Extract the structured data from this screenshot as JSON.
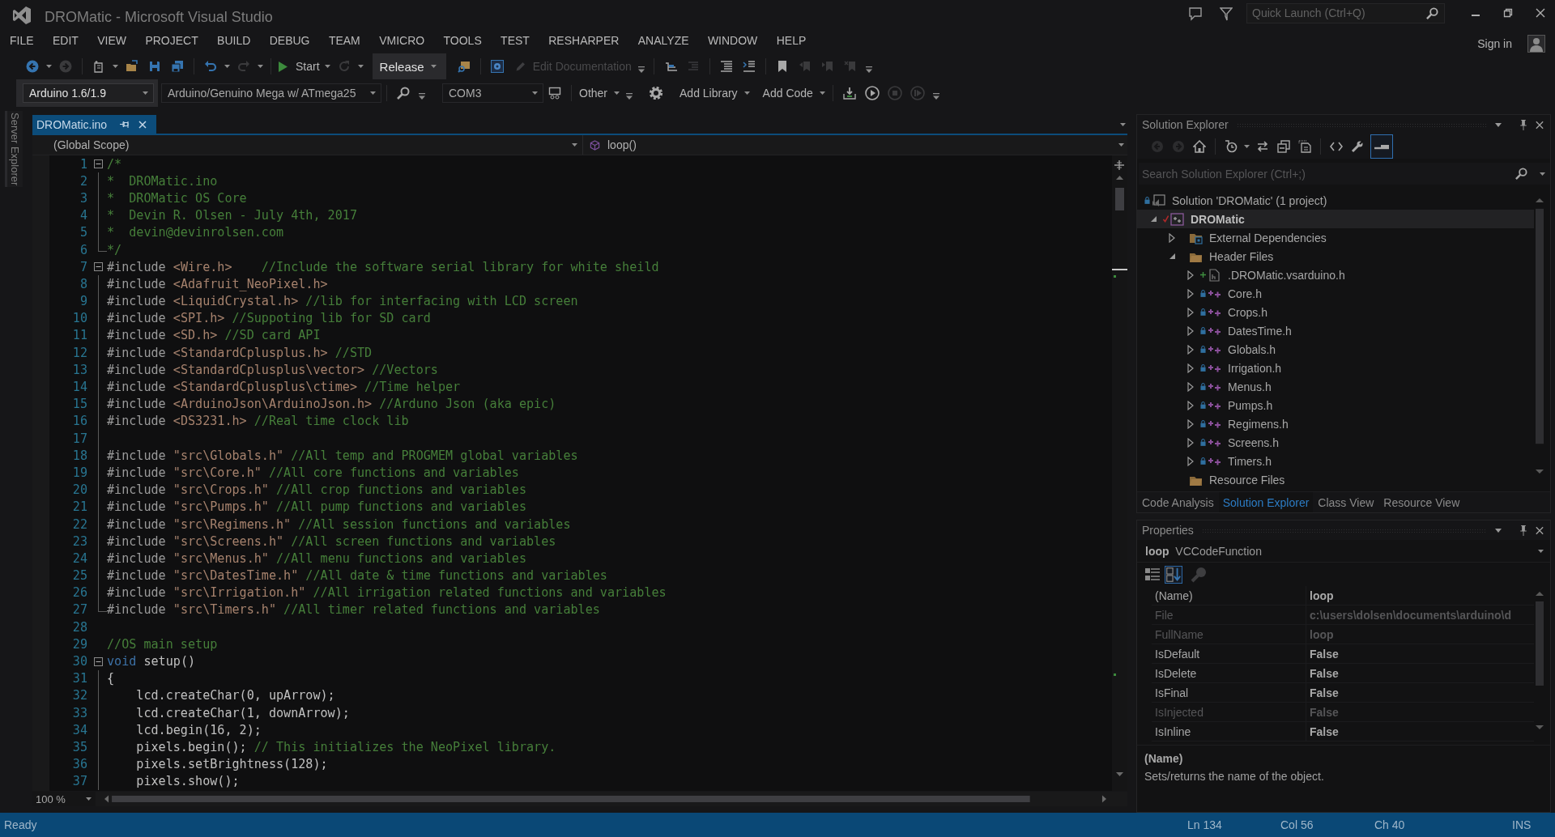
{
  "window": {
    "title": "DROMatic - Microsoft Visual Studio",
    "quick_launch": {
      "placeholder": "Quick Launch (Ctrl+Q)"
    }
  },
  "menu": [
    "FILE",
    "EDIT",
    "VIEW",
    "PROJECT",
    "BUILD",
    "DEBUG",
    "TEAM",
    "VMICRO",
    "TOOLS",
    "TEST",
    "RESHARPER",
    "ANALYZE",
    "WINDOW",
    "HELP"
  ],
  "account": {
    "sign_in": "Sign in"
  },
  "toolbar_1": {
    "start": "Start",
    "configuration": "Release",
    "edit_documentation": {
      "label": "Edit Documentation",
      "disabled": true
    }
  },
  "toolbar_2": {
    "ide_version": "Arduino 1.6/1.9",
    "board": "Arduino/Genuino Mega w/ ATmega25",
    "port": "COM3",
    "other": "Other",
    "add_library": "Add Library",
    "add_code": "Add Code"
  },
  "side_tabs": [
    "Server Explorer"
  ],
  "document_tabs": [
    {
      "label": "DROMatic.ino",
      "selected": true
    }
  ],
  "navigation": {
    "scope": "(Global Scope)",
    "member": "loop()"
  },
  "code": {
    "lines": [
      {
        "number": "1",
        "kind": "start",
        "segments": [
          {
            "kind": "comment",
            "text": "/*"
          }
        ]
      },
      {
        "number": "2",
        "kind": "inside",
        "segments": [
          {
            "kind": "comment",
            "text": "*  DROMatic.ino"
          }
        ]
      },
      {
        "number": "3",
        "kind": "inside",
        "segments": [
          {
            "kind": "comment",
            "text": "*  DROMatic OS Core"
          }
        ]
      },
      {
        "number": "4",
        "kind": "inside",
        "segments": [
          {
            "kind": "comment",
            "text": "*  Devin R. Olsen - July 4th, 2017"
          }
        ]
      },
      {
        "number": "5",
        "kind": "inside",
        "segments": [
          {
            "kind": "comment",
            "text": "*  devin@devinrolsen.com"
          }
        ]
      },
      {
        "number": "6",
        "kind": "end",
        "segments": [
          {
            "kind": "comment",
            "text": "*/"
          }
        ]
      },
      {
        "number": "7",
        "kind": "start",
        "segments": [
          {
            "kind": "directive",
            "text": "#include"
          },
          {
            "kind": "header",
            "text": " <Wire.h>"
          },
          {
            "kind": "comment",
            "text": "    //Include the software serial library for white sheild"
          }
        ]
      },
      {
        "number": "8",
        "kind": "inside",
        "segments": [
          {
            "kind": "directive",
            "text": "#include"
          },
          {
            "kind": "header",
            "text": " <Adafruit_NeoPixel.h>"
          }
        ]
      },
      {
        "number": "9",
        "kind": "inside",
        "segments": [
          {
            "kind": "directive",
            "text": "#include"
          },
          {
            "kind": "header",
            "text": " <LiquidCrystal.h>"
          },
          {
            "kind": "comment",
            "text": " //lib for interfacing with LCD screen"
          }
        ]
      },
      {
        "number": "10",
        "kind": "inside",
        "segments": [
          {
            "kind": "directive",
            "text": "#include"
          },
          {
            "kind": "header",
            "text": " <SPI.h>"
          },
          {
            "kind": "comment",
            "text": " //Suppoting lib for SD card"
          }
        ]
      },
      {
        "number": "11",
        "kind": "inside",
        "segments": [
          {
            "kind": "directive",
            "text": "#include"
          },
          {
            "kind": "header",
            "text": " <SD.h>"
          },
          {
            "kind": "comment",
            "text": " //SD card API"
          }
        ]
      },
      {
        "number": "12",
        "kind": "inside",
        "segments": [
          {
            "kind": "directive",
            "text": "#include"
          },
          {
            "kind": "header",
            "text": " <StandardCplusplus.h>"
          },
          {
            "kind": "comment",
            "text": " //STD"
          }
        ]
      },
      {
        "number": "13",
        "kind": "inside",
        "segments": [
          {
            "kind": "directive",
            "text": "#include"
          },
          {
            "kind": "header",
            "text": " <StandardCplusplus\\vector>"
          },
          {
            "kind": "comment",
            "text": " //Vectors"
          }
        ]
      },
      {
        "number": "14",
        "kind": "inside",
        "segments": [
          {
            "kind": "directive",
            "text": "#include"
          },
          {
            "kind": "header",
            "text": " <StandardCplusplus\\ctime>"
          },
          {
            "kind": "comment",
            "text": " //Time helper"
          }
        ]
      },
      {
        "number": "15",
        "kind": "inside",
        "segments": [
          {
            "kind": "directive",
            "text": "#include"
          },
          {
            "kind": "header",
            "text": " <ArduinoJson\\ArduinoJson.h>"
          },
          {
            "kind": "comment",
            "text": " //Arduno Json (aka epic)"
          }
        ]
      },
      {
        "number": "16",
        "kind": "inside",
        "segments": [
          {
            "kind": "directive",
            "text": "#include"
          },
          {
            "kind": "header",
            "text": " <DS3231.h>"
          },
          {
            "kind": "comment",
            "text": " //Real time clock lib"
          }
        ]
      },
      {
        "number": "17",
        "kind": "inside"
      },
      {
        "number": "18",
        "kind": "inside",
        "segments": [
          {
            "kind": "directive",
            "text": "#include"
          },
          {
            "kind": "string",
            "text": " \"src\\Globals.h\""
          },
          {
            "kind": "comment",
            "text": " //All temp and PROGMEM global variables"
          }
        ]
      },
      {
        "number": "19",
        "kind": "inside",
        "segments": [
          {
            "kind": "directive",
            "text": "#include"
          },
          {
            "kind": "string",
            "text": " \"src\\Core.h\""
          },
          {
            "kind": "comment",
            "text": " //All core functions and variables"
          }
        ]
      },
      {
        "number": "20",
        "kind": "inside",
        "segments": [
          {
            "kind": "directive",
            "text": "#include"
          },
          {
            "kind": "string",
            "text": " \"src\\Crops.h\""
          },
          {
            "kind": "comment",
            "text": " //All crop functions and variables"
          }
        ]
      },
      {
        "number": "21",
        "kind": "inside",
        "segments": [
          {
            "kind": "directive",
            "text": "#include"
          },
          {
            "kind": "string",
            "text": " \"src\\Pumps.h\""
          },
          {
            "kind": "comment",
            "text": " //All pump functions and variables"
          }
        ]
      },
      {
        "number": "22",
        "kind": "inside",
        "segments": [
          {
            "kind": "directive",
            "text": "#include"
          },
          {
            "kind": "string",
            "text": " \"src\\Regimens.h\""
          },
          {
            "kind": "comment",
            "text": " //All session functions and variables"
          }
        ]
      },
      {
        "number": "23",
        "kind": "inside",
        "segments": [
          {
            "kind": "directive",
            "text": "#include"
          },
          {
            "kind": "string",
            "text": " \"src\\Screens.h\""
          },
          {
            "kind": "comment",
            "text": " //All screen functions and variables"
          }
        ]
      },
      {
        "number": "24",
        "kind": "inside",
        "segments": [
          {
            "kind": "directive",
            "text": "#include"
          },
          {
            "kind": "string",
            "text": " \"src\\Menus.h\""
          },
          {
            "kind": "comment",
            "text": " //All menu functions and variables"
          }
        ]
      },
      {
        "number": "25",
        "kind": "inside",
        "segments": [
          {
            "kind": "directive",
            "text": "#include"
          },
          {
            "kind": "string",
            "text": " \"src\\DatesTime.h\""
          },
          {
            "kind": "comment",
            "text": " //All date & time functions and variables"
          }
        ]
      },
      {
        "number": "26",
        "kind": "inside",
        "segments": [
          {
            "kind": "directive",
            "text": "#include"
          },
          {
            "kind": "string",
            "text": " \"src\\Irrigation.h\""
          },
          {
            "kind": "comment",
            "text": " //All irrigation related functions and variables"
          }
        ]
      },
      {
        "number": "27",
        "kind": "end",
        "segments": [
          {
            "kind": "directive",
            "text": "#include"
          },
          {
            "kind": "string",
            "text": " \"src\\Timers.h\""
          },
          {
            "kind": "comment",
            "text": " //All timer related functions and variables"
          }
        ]
      },
      {
        "number": "28",
        "kind": "plain"
      },
      {
        "number": "29",
        "kind": "plain",
        "segments": [
          {
            "kind": "comment",
            "text": "//OS main setup"
          }
        ]
      },
      {
        "number": "30",
        "kind": "start",
        "segments": [
          {
            "kind": "keyword",
            "text": "void"
          },
          {
            "kind": "plain",
            "text": " setup()"
          }
        ]
      },
      {
        "number": "31",
        "kind": "inside",
        "segments": [
          {
            "kind": "plain",
            "text": "{"
          }
        ]
      },
      {
        "number": "32",
        "kind": "inside",
        "segments": [
          {
            "kind": "plain",
            "text": "    lcd.createChar(0, upArrow);"
          }
        ]
      },
      {
        "number": "33",
        "kind": "inside",
        "segments": [
          {
            "kind": "plain",
            "text": "    lcd.createChar(1, downArrow);"
          }
        ]
      },
      {
        "number": "34",
        "kind": "inside",
        "segments": [
          {
            "kind": "plain",
            "text": "    lcd.begin(16, 2);"
          }
        ]
      },
      {
        "number": "35",
        "kind": "inside",
        "segments": [
          {
            "kind": "plain",
            "text": "    pixels.begin();"
          },
          {
            "kind": "comment",
            "text": " // This initializes the NeoPixel library."
          }
        ]
      },
      {
        "number": "36",
        "kind": "inside",
        "segments": [
          {
            "kind": "plain",
            "text": "    pixels.setBrightness(128);"
          }
        ]
      },
      {
        "number": "37",
        "kind": "inside",
        "segments": [
          {
            "kind": "plain",
            "text": "    pixels.show();"
          }
        ]
      }
    ]
  },
  "zoom": "100 %",
  "solution_explorer": {
    "title": "Solution Explorer",
    "preview_selected": true,
    "search": {
      "placeholder": "Search Solution Explorer (Ctrl+;)"
    },
    "tree": [
      {
        "label": "Solution 'DROMatic' (1 project)",
        "kind": "solution",
        "checked_in": true,
        "pending_add": false,
        "checked_out": false,
        "selected": false,
        "children": [
          {
            "label": "DROMatic",
            "kind": "project",
            "expanded": true,
            "checked_in": false,
            "pending_add": false,
            "checked_out": true,
            "selected": true,
            "children": [
              {
                "label": "External Dependencies",
                "kind": "dependencies",
                "expanded": false,
                "checked_in": false,
                "pending_add": false,
                "checked_out": false,
                "selected": false
              },
              {
                "label": "Header Files",
                "kind": "folder",
                "expanded": true,
                "checked_in": false,
                "pending_add": false,
                "checked_out": false,
                "selected": false,
                "children": [
                  {
                    "label": ".DROMatic.vsarduino.h",
                    "kind": "file",
                    "expanded": false,
                    "checked_in": false,
                    "pending_add": true,
                    "checked_out": false,
                    "selected": false
                  },
                  {
                    "label": "Core.h",
                    "kind": "header",
                    "expanded": false,
                    "checked_in": true,
                    "pending_add": false,
                    "checked_out": false,
                    "selected": false
                  },
                  {
                    "label": "Crops.h",
                    "kind": "header",
                    "expanded": false,
                    "checked_in": true,
                    "pending_add": false,
                    "checked_out": false,
                    "selected": false
                  },
                  {
                    "label": "DatesTime.h",
                    "kind": "header",
                    "expanded": false,
                    "checked_in": true,
                    "pending_add": false,
                    "checked_out": false,
                    "selected": false
                  },
                  {
                    "label": "Globals.h",
                    "kind": "header",
                    "expanded": false,
                    "checked_in": true,
                    "pending_add": false,
                    "checked_out": false,
                    "selected": false
                  },
                  {
                    "label": "Irrigation.h",
                    "kind": "header",
                    "expanded": false,
                    "checked_in": true,
                    "pending_add": false,
                    "checked_out": false,
                    "selected": false
                  },
                  {
                    "label": "Menus.h",
                    "kind": "header",
                    "expanded": false,
                    "checked_in": true,
                    "pending_add": false,
                    "checked_out": false,
                    "selected": false
                  },
                  {
                    "label": "Pumps.h",
                    "kind": "header",
                    "expanded": false,
                    "checked_in": true,
                    "pending_add": false,
                    "checked_out": false,
                    "selected": false
                  },
                  {
                    "label": "Regimens.h",
                    "kind": "header",
                    "expanded": false,
                    "checked_in": true,
                    "pending_add": false,
                    "checked_out": false,
                    "selected": false
                  },
                  {
                    "label": "Screens.h",
                    "kind": "header",
                    "expanded": false,
                    "checked_in": true,
                    "pending_add": false,
                    "checked_out": false,
                    "selected": false
                  },
                  {
                    "label": "Timers.h",
                    "kind": "header",
                    "expanded": false,
                    "checked_in": true,
                    "pending_add": false,
                    "checked_out": false,
                    "selected": false
                  }
                ]
              },
              {
                "label": "Resource Files",
                "kind": "empty_folder",
                "expanded": false,
                "checked_in": false,
                "pending_add": false,
                "checked_out": false,
                "selected": false
              }
            ]
          }
        ]
      }
    ],
    "tabs": [
      {
        "label": "Code Analysis",
        "selected": false
      },
      {
        "label": "Solution Explorer",
        "selected": true
      },
      {
        "label": "Class View",
        "selected": false
      },
      {
        "label": "Resource View",
        "selected": false
      }
    ]
  },
  "properties": {
    "title": "Properties",
    "object_name": "loop",
    "object_type": "VCCodeFunction",
    "sort_alphabetical": true,
    "rows": [
      {
        "name": "(Name)",
        "value": "loop",
        "disabled": false
      },
      {
        "name": "File",
        "value": "c:\\users\\dolsen\\documents\\arduino\\d",
        "disabled": true
      },
      {
        "name": "FullName",
        "value": "loop",
        "disabled": true
      },
      {
        "name": "IsDefault",
        "value": "False",
        "disabled": false
      },
      {
        "name": "IsDelete",
        "value": "False",
        "disabled": false
      },
      {
        "name": "IsFinal",
        "value": "False",
        "disabled": false
      },
      {
        "name": "IsInjected",
        "value": "False",
        "disabled": true
      },
      {
        "name": "IsInline",
        "value": "False",
        "disabled": false
      }
    ],
    "description": {
      "title": "(Name)",
      "text": "Sets/returns the name of the object."
    }
  },
  "status_bar": {
    "message": "Ready",
    "line": "Ln 134",
    "column": "Col 56",
    "char": "Ch 40",
    "mode": "INS"
  }
}
